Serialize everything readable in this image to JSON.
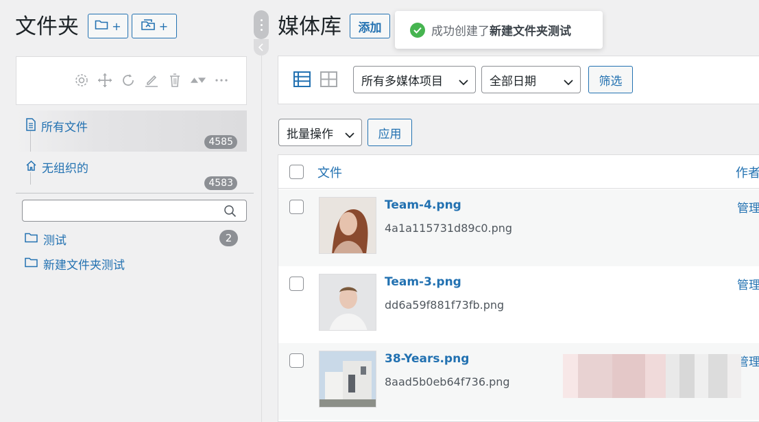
{
  "left": {
    "title": "文件夹",
    "new_folder_plus": "+",
    "new_subfolder_plus": "+",
    "tree": [
      {
        "label": "所有文件",
        "count": "4585"
      },
      {
        "label": "无组织的",
        "count": "4583"
      }
    ],
    "search": {
      "placeholder": "",
      "value": ""
    },
    "folders": [
      {
        "label": "测试",
        "count": "2"
      },
      {
        "label": "新建文件夹测试",
        "count": ""
      }
    ]
  },
  "main": {
    "title": "媒体库",
    "add_label": "添加",
    "toast": {
      "prefix": "成功创建了",
      "name": "新建文件夹测试"
    },
    "filters": {
      "type_selected": "所有多媒体项目",
      "date_selected": "全部日期",
      "filter_label": "筛选"
    },
    "bulk": {
      "selected": "批量操作",
      "apply_label": "应用"
    },
    "table": {
      "col_file": "文件",
      "col_author": "作者",
      "rows": [
        {
          "title": "Team-4.png",
          "filename": "4a1a115731d89c0.png",
          "author": "管理"
        },
        {
          "title": "Team-3.png",
          "filename": "dd6a59f881f73fb.png",
          "author": "管理"
        },
        {
          "title": "38-Years.png",
          "filename": "8aad5b0eb64f736.png",
          "author": "管理"
        }
      ]
    }
  },
  "colors": {
    "accent": "#2271b1",
    "success": "#46b450",
    "badge": "#8c8f94"
  }
}
